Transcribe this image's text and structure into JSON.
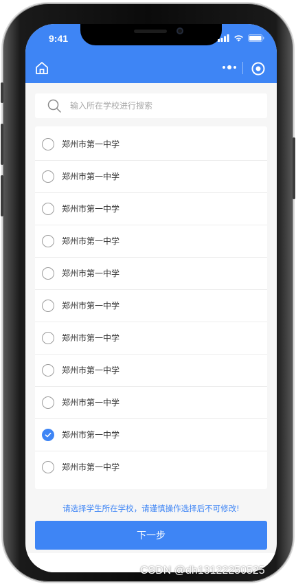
{
  "status_bar": {
    "time": "9:41"
  },
  "nav": {
    "home_icon": "home-icon",
    "more_icon": "more-dots-icon",
    "close_icon": "target-circle-icon"
  },
  "search": {
    "placeholder": "输入所在学校进行搜索",
    "icon": "search-icon"
  },
  "schools": [
    {
      "name": "郑州市第一中学",
      "selected": false
    },
    {
      "name": "郑州市第一中学",
      "selected": false
    },
    {
      "name": "郑州市第一中学",
      "selected": false
    },
    {
      "name": "郑州市第一中学",
      "selected": false
    },
    {
      "name": "郑州市第一中学",
      "selected": false
    },
    {
      "name": "郑州市第一中学",
      "selected": false
    },
    {
      "name": "郑州市第一中学",
      "selected": false
    },
    {
      "name": "郑州市第一中学",
      "selected": false
    },
    {
      "name": "郑州市第一中学",
      "selected": false
    },
    {
      "name": "郑州市第一中学",
      "selected": true
    },
    {
      "name": "郑州市第一中学",
      "selected": false
    }
  ],
  "notice": "请选择学生所在学校，请谨慎操作选择后不可修改!",
  "next_button": "下一步",
  "watermark": "CSDN @dh13122250525",
  "colors": {
    "primary": "#3e85f5",
    "background": "#f6f6f6"
  }
}
